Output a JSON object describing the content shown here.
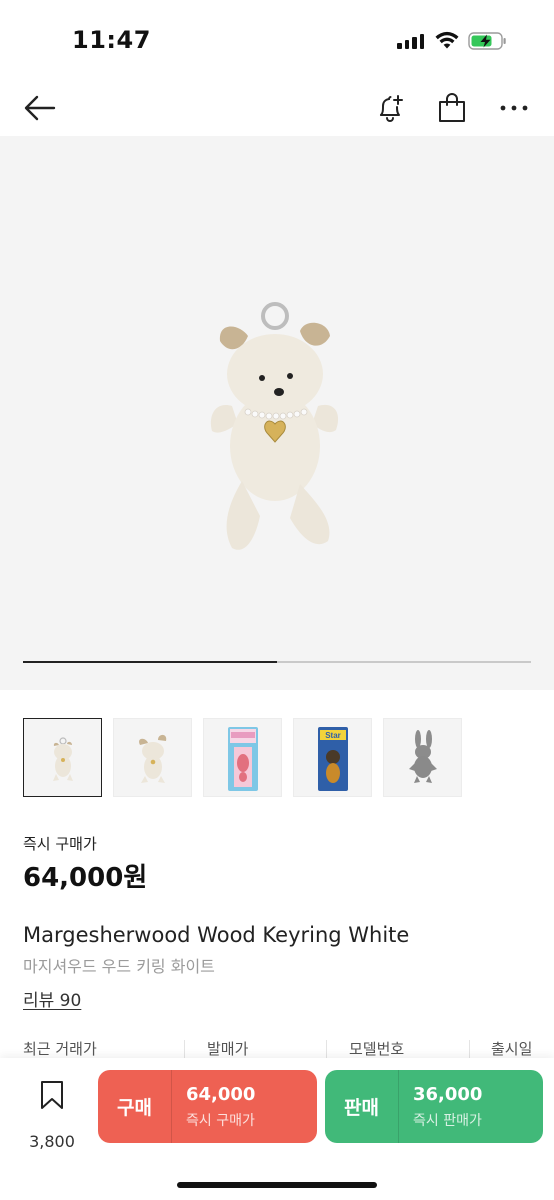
{
  "status_bar": {
    "time": "11:47"
  },
  "nav": {
    "back_icon": "arrow-left-icon",
    "alert_icon": "bell-plus-icon",
    "bag_icon": "shopping-bag-icon",
    "more_icon": "more-horizontal-icon"
  },
  "hero": {
    "image": "white-teddy-bear-keyring",
    "progress": 0.5
  },
  "thumbnails": [
    {
      "name": "bear-white-front",
      "active": true
    },
    {
      "name": "bear-white-angle",
      "active": false
    },
    {
      "name": "pink-bear-package",
      "active": false
    },
    {
      "name": "star-bear-package",
      "active": false
    },
    {
      "name": "gray-rabbit",
      "active": false
    }
  ],
  "price": {
    "label": "즉시 구매가",
    "value": "64,000원"
  },
  "product": {
    "name_en": "Margesherwood Wood Keyring White",
    "name_ko": "마지셔우드 우드 키링 화이트",
    "review": "리뷰 90"
  },
  "info": {
    "recent_trade": "최근 거래가",
    "release_price": "발매가",
    "model_no": "모델번호",
    "release_date": "출시일"
  },
  "bottom": {
    "save_count": "3,800",
    "buy": {
      "tag": "구매",
      "price": "64,000",
      "sub": "즉시 구매가",
      "color": "#ee6153"
    },
    "sell": {
      "tag": "판매",
      "price": "36,000",
      "sub": "즉시 판매가",
      "color": "#41b979"
    }
  }
}
